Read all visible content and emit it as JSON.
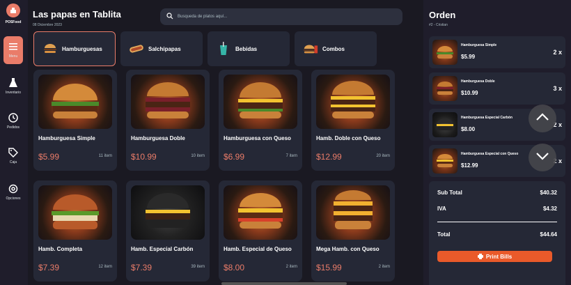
{
  "app": {
    "logo_text": "POSFood"
  },
  "sidebar": {
    "items": [
      {
        "label": "Menu",
        "icon": "menu-icon",
        "active": true
      },
      {
        "label": "Inventario",
        "icon": "flask-icon"
      },
      {
        "label": "Pedidos",
        "icon": "clock-icon"
      },
      {
        "label": "Caja",
        "icon": "tag-icon"
      },
      {
        "label": "Opciones",
        "icon": "settings-icon"
      }
    ]
  },
  "header": {
    "title": "Las papas en Tablita",
    "date": "08 Diciembre 2023",
    "search_placeholder": "Busqueda de platos aquí..."
  },
  "categories": [
    {
      "label": "Hamburguesas",
      "icon": "burger-icon",
      "active": true
    },
    {
      "label": "Salchipapas",
      "icon": "hotdog-icon"
    },
    {
      "label": "Bebidas",
      "icon": "drink-icon"
    },
    {
      "label": "Combos",
      "icon": "combo-icon"
    }
  ],
  "products": [
    {
      "name": "Hamburguesa Simple",
      "price": "$5.99",
      "count": "11 item"
    },
    {
      "name": "Hamburguesa Doble",
      "price": "$10.99",
      "count": "10 item"
    },
    {
      "name": "Hamburguesa con Queso",
      "price": "$6.99",
      "count": "7 item"
    },
    {
      "name": "Hamb. Doble con Queso",
      "price": "$12.99",
      "count": "20 item"
    },
    {
      "name": "Hamb. Completa",
      "price": "$7.39",
      "count": "12 item"
    },
    {
      "name": "Hamb. Especial Carbón",
      "price": "$7.39",
      "count": "39 item"
    },
    {
      "name": "Hamb. Especial de Queso",
      "price": "$8.00",
      "count": "2 item"
    },
    {
      "name": "Mega Hamb. con Queso",
      "price": "$15.99",
      "count": "2 item"
    }
  ],
  "order": {
    "title": "Orden",
    "subtitle": "#2 - Cristian",
    "items": [
      {
        "name": "Hamburguesa Simple",
        "price": "$5.99",
        "qty": "2 x"
      },
      {
        "name": "Hamburguesa Doble",
        "price": "$10.99",
        "qty": "3 x"
      },
      {
        "name": "Hamburguesa Especial Carbón",
        "price": "$8.00",
        "qty": "2 x"
      },
      {
        "name": "Hamburguesa Especial con Queso",
        "price": "$12.99",
        "qty": "2 x"
      }
    ],
    "subtotal_label": "Sub Total",
    "subtotal": "$40.32",
    "tax_label": "IVA",
    "tax": "$4.32",
    "total_label": "Total",
    "total": "$44.64",
    "print_label": "Print Bills"
  },
  "colors": {
    "accent": "#ea7c69",
    "button": "#ea5a2a",
    "panel": "#252836",
    "background": "#1a1922"
  }
}
